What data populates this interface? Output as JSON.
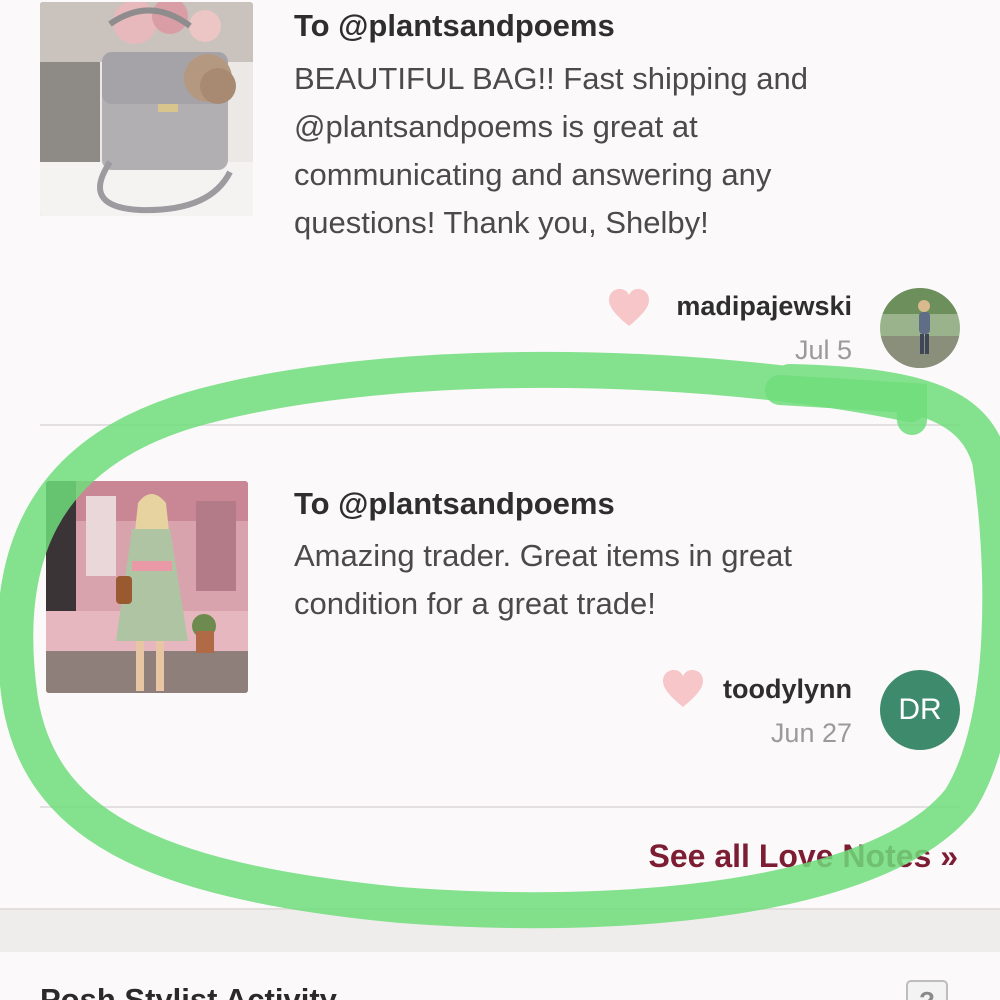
{
  "love_notes": [
    {
      "recipient_label": "To @plantsandpoems",
      "message": "BEAUTIFUL BAG!! Fast shipping and @plantsandpoems is great at communicating and answering any questions! Thank you, Shelby!",
      "author": "madipajewski",
      "date": "Jul 5",
      "thumbnail_icon": "handbag-photo",
      "avatar_icon": "user-photo-avatar"
    },
    {
      "recipient_label": "To @plantsandpoems",
      "message": "Amazing trader. Great items in great condition for a great trade!",
      "author": "toodylynn",
      "date": "Jun 27",
      "thumbnail_icon": "dress-photo",
      "avatar_initials": "DR"
    }
  ],
  "see_all_link": "See all Love Notes »",
  "stylist_section": {
    "title": "Posh Stylist Activity",
    "help_label": "?"
  },
  "colors": {
    "heart": "#f7c6c9",
    "link": "#7d1d34",
    "avatar_bg": "#3d8b6c",
    "annotation_stroke": "#6fdd7a"
  }
}
